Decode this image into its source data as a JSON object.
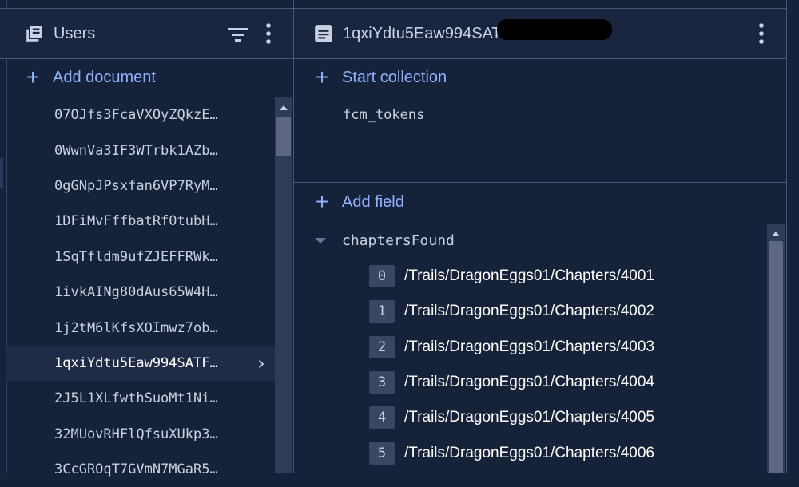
{
  "collection": {
    "title": "Users",
    "add_document_label": "Add document",
    "documents": [
      {
        "id": "07OJfs3FcaVXOyZQkzE…"
      },
      {
        "id": "0WwnVa3IF3WTrbk1AZb…"
      },
      {
        "id": "0gGNpJPsxfan6VP7RyM…"
      },
      {
        "id": "1DFiMvFffbatRf0tubH…"
      },
      {
        "id": "1SqTfldm9ufZJEFFRWk…"
      },
      {
        "id": "1ivkAINg80dAus65W4H…"
      },
      {
        "id": "1j2tM6lKfsXOImwz7ob…"
      },
      {
        "id": "1qxiYdtu5Eaw994SATF…",
        "selected": true
      },
      {
        "id": "2J5L1XLfwthSuoMt1Ni…"
      },
      {
        "id": "32MUovRHFlQfsuXUkp3…"
      },
      {
        "id": "3CcGROqT7GVmN7MGaR5…"
      }
    ]
  },
  "document": {
    "title": "1qxiYdtu5Eaw994SATF",
    "start_collection_label": "Start collection",
    "subcollections": [
      "fcm_tokens"
    ],
    "add_field_label": "Add field",
    "field": {
      "name": "chaptersFound",
      "items": [
        {
          "index": "0",
          "value": "/Trails/DragonEggs01/Chapters/4001"
        },
        {
          "index": "1",
          "value": "/Trails/DragonEggs01/Chapters/4002"
        },
        {
          "index": "2",
          "value": "/Trails/DragonEggs01/Chapters/4003"
        },
        {
          "index": "3",
          "value": "/Trails/DragonEggs01/Chapters/4004"
        },
        {
          "index": "4",
          "value": "/Trails/DragonEggs01/Chapters/4005"
        },
        {
          "index": "5",
          "value": "/Trails/DragonEggs01/Chapters/4006"
        }
      ]
    }
  },
  "icons": {
    "collection": "collection-icon",
    "filter": "filter-icon",
    "more": "more-vert-icon",
    "document": "document-icon",
    "add": "plus-icon",
    "expand": "triangle-down-icon",
    "open": "chevron-right-icon"
  },
  "colors": {
    "background": "#16213a",
    "accent": "#8fb3ff",
    "selected_row": "#1f2c48",
    "divider": "#4a5671"
  }
}
